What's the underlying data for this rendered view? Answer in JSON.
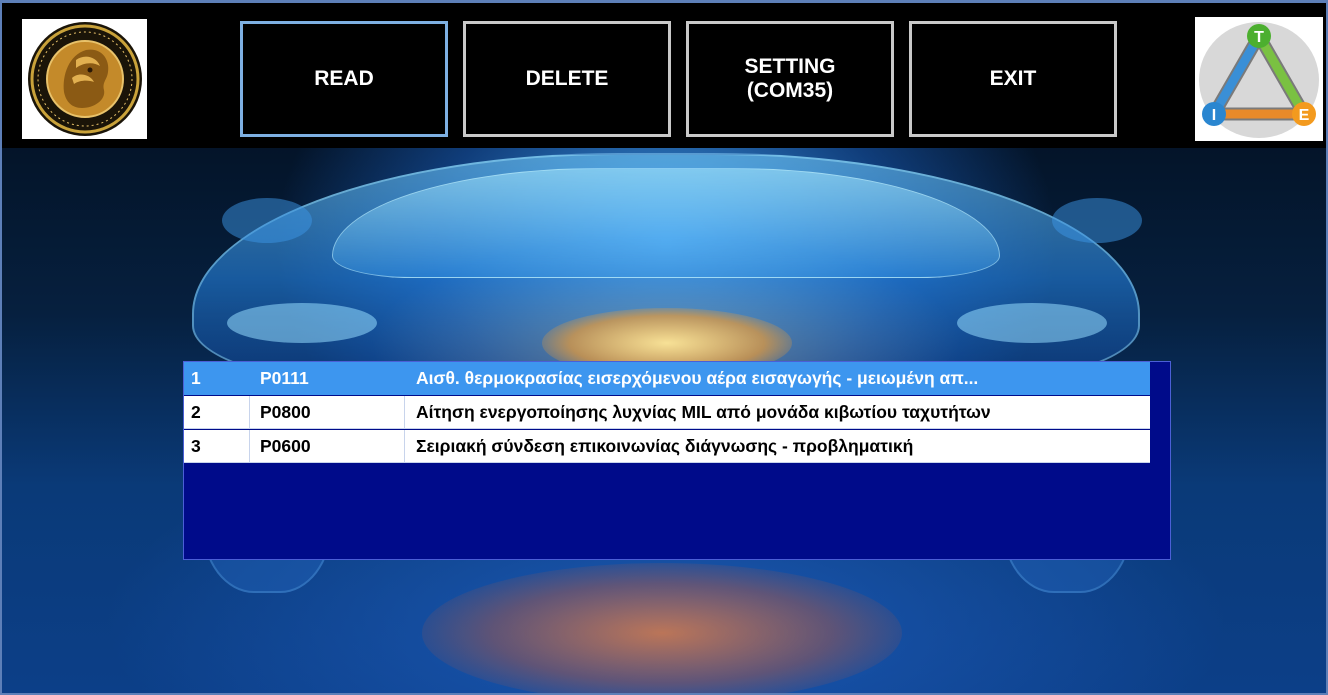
{
  "toolbar": {
    "buttons": [
      {
        "id": "read",
        "label": "READ"
      },
      {
        "id": "delete",
        "label": "DELETE"
      },
      {
        "id": "setting",
        "label": "SETTING\n(COM35)"
      },
      {
        "id": "exit",
        "label": "EXIT"
      }
    ],
    "logo_left": {
      "icon": "university-seal-icon",
      "accent": "#8b6b1e"
    },
    "logo_right": {
      "icon": "tie-triangle-logo-icon",
      "letters": [
        "T",
        "I",
        "E"
      ]
    }
  },
  "dtc_list": {
    "selected_index": 0,
    "rows": [
      {
        "num": "1",
        "code": "P0111",
        "desc": "Αισθ. θερμοκρασίας εισερχόμενου αέρα εισαγωγής - μειωμένη απ..."
      },
      {
        "num": "2",
        "code": "P0800",
        "desc": "Αίτηση ενεργοποίησης λυχνίας MIL από μονάδα κιβωτίου ταχυτήτων"
      },
      {
        "num": "3",
        "code": "P0600",
        "desc": "Σειριακή σύνδεση επικοινωνίας διάγνωσης - προβληματική"
      }
    ]
  },
  "colors": {
    "list_background": "#000b8a",
    "selected_row": "#3d96ef",
    "button_border": "#c9c9c9",
    "active_button_border": "#7eb0e2"
  }
}
